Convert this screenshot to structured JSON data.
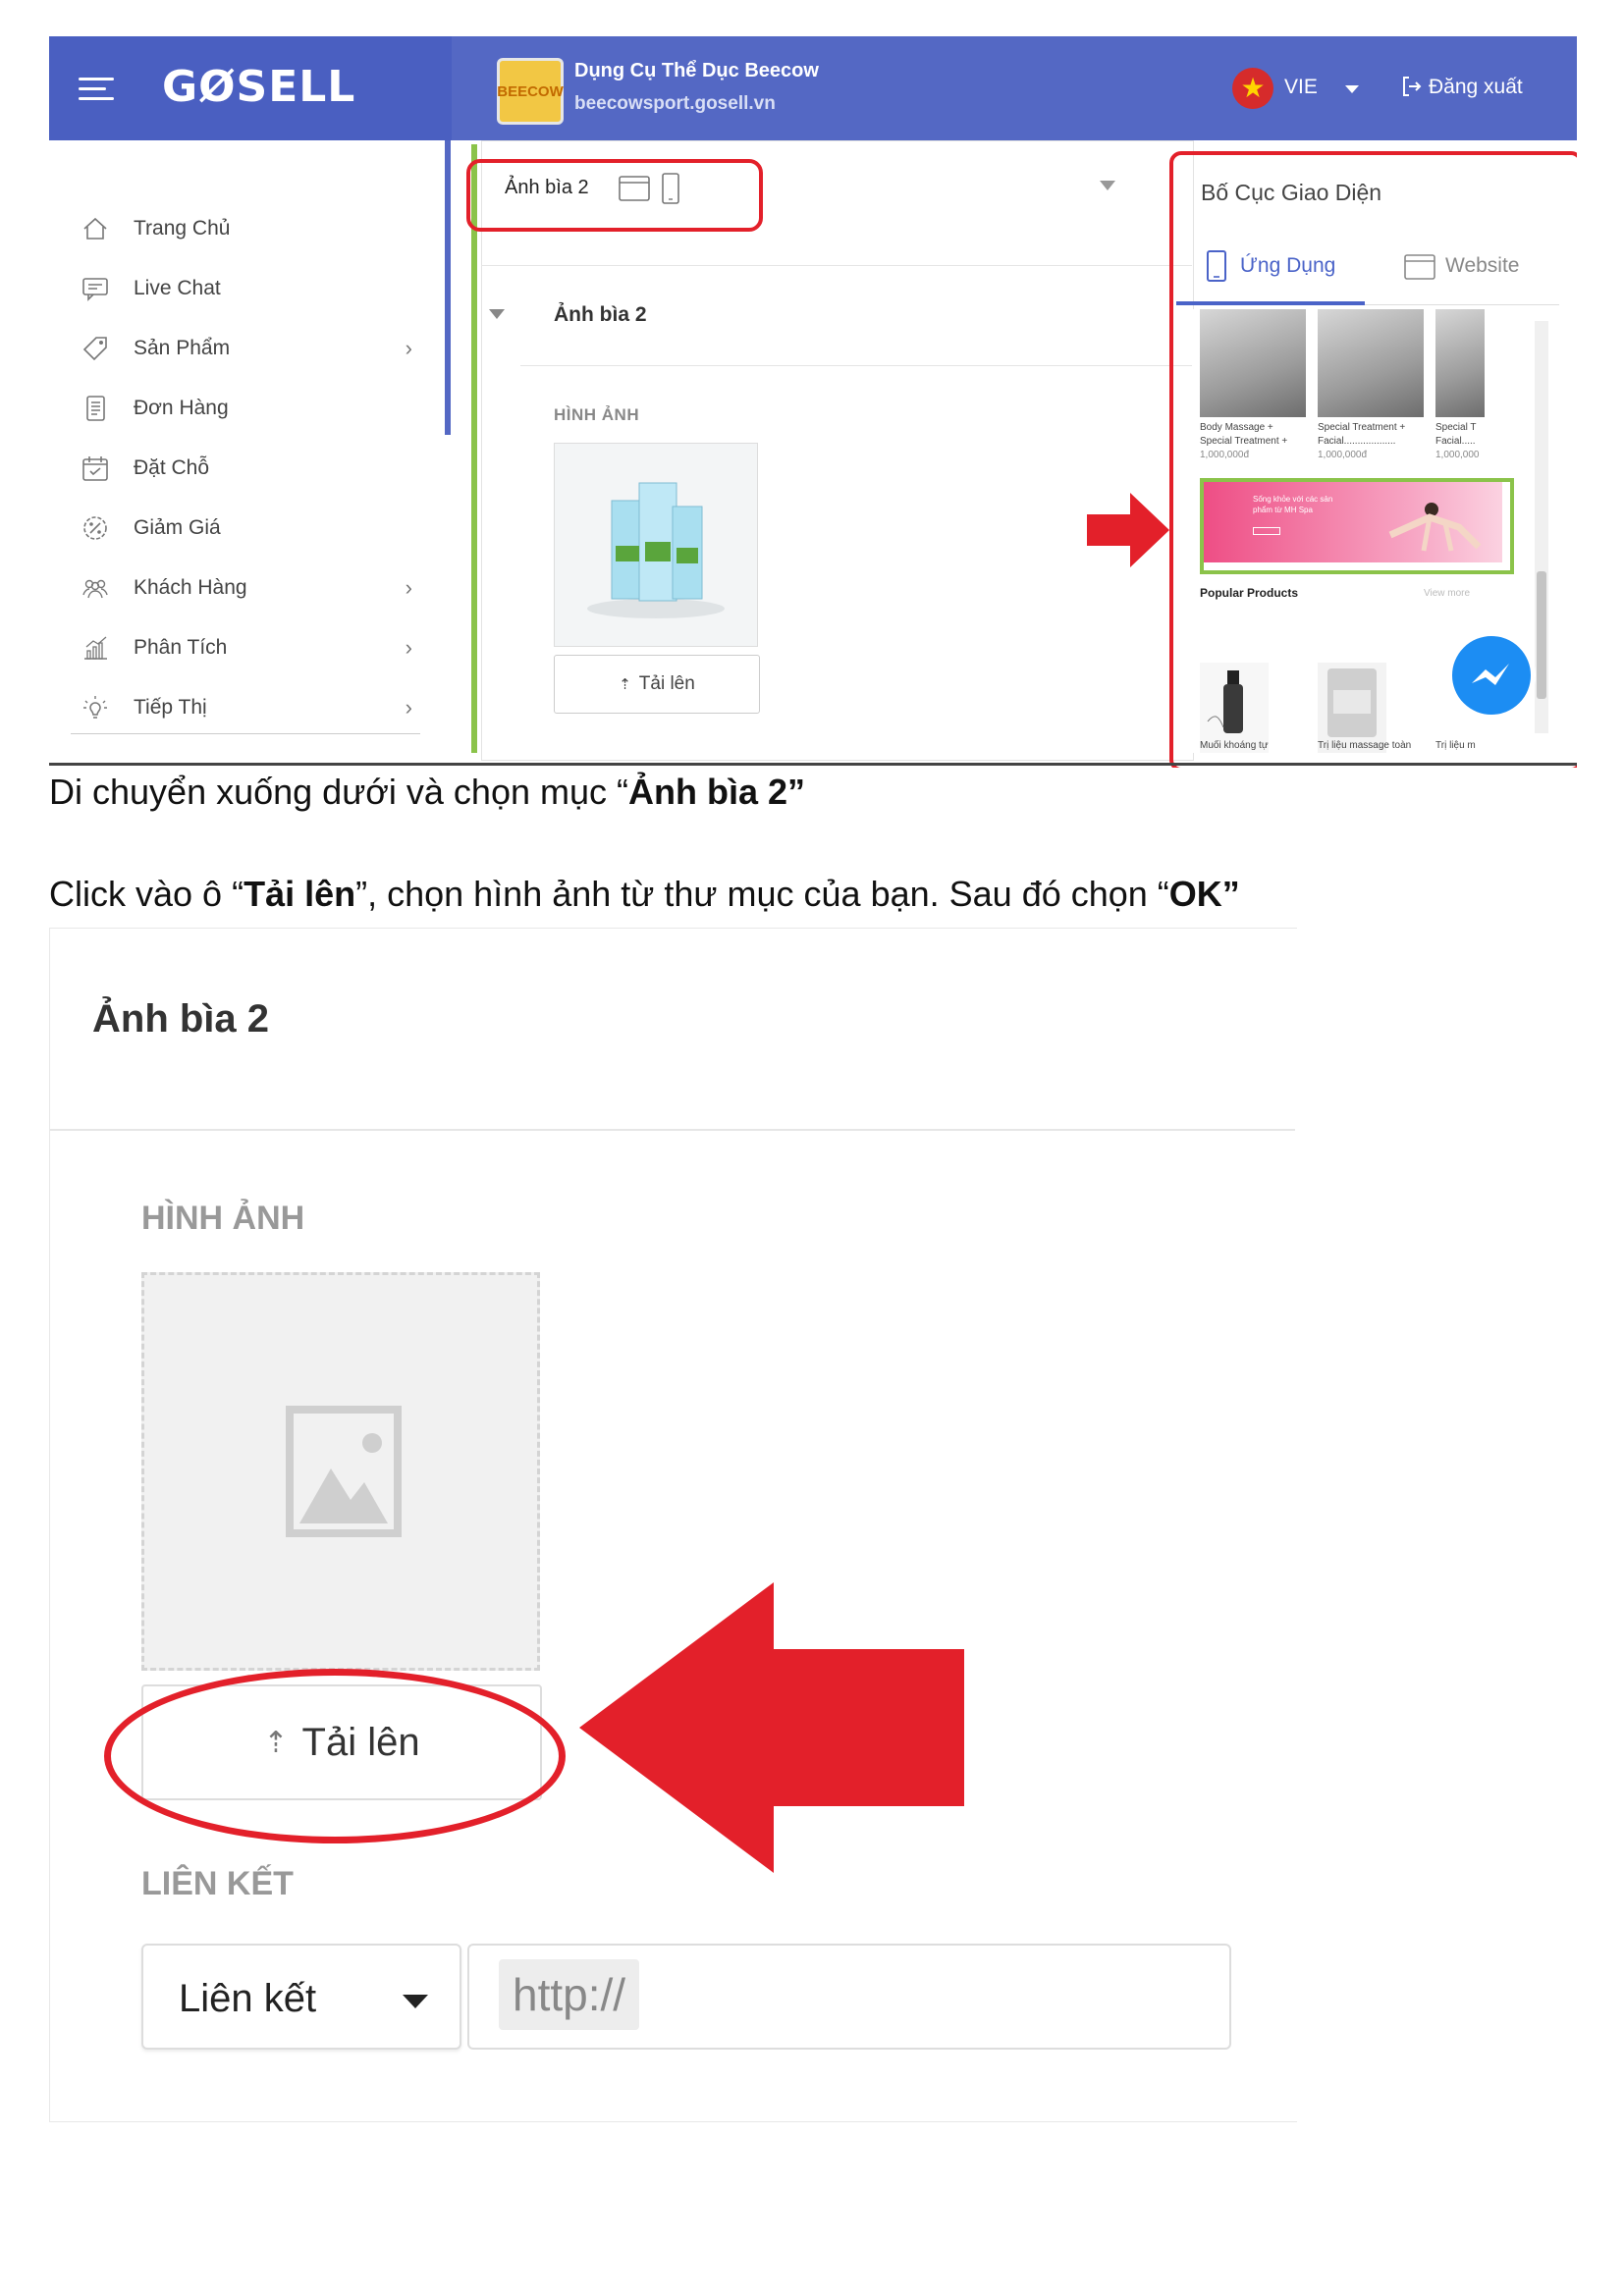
{
  "shot1": {
    "app_logo": "GØSELL",
    "shop": {
      "logo_text": "BEECOW",
      "name": "Dụng Cụ Thể Dục Beecow",
      "url": "beecowsport.gosell.vn"
    },
    "lang": "VIE",
    "logout": "Đăng xuất",
    "sidebar": {
      "items": [
        {
          "label": "Trang Chủ",
          "icon": "home-icon",
          "chevron": ""
        },
        {
          "label": "Live Chat",
          "icon": "chat-icon",
          "chevron": ""
        },
        {
          "label": "Sản Phẩm",
          "icon": "tag-icon",
          "chevron": "›"
        },
        {
          "label": "Đơn Hàng",
          "icon": "receipt-icon",
          "chevron": ""
        },
        {
          "label": "Đặt Chỗ",
          "icon": "calendar-icon",
          "chevron": ""
        },
        {
          "label": "Giảm Giá",
          "icon": "discount-icon",
          "chevron": ""
        },
        {
          "label": "Khách Hàng",
          "icon": "customers-icon",
          "chevron": "›"
        },
        {
          "label": "Phân Tích",
          "icon": "analytics-icon",
          "chevron": "›"
        },
        {
          "label": "Tiếp Thị",
          "icon": "bulb-icon",
          "chevron": "›"
        }
      ]
    },
    "editor": {
      "tab_label": "Ảnh bìa 2",
      "section_title": "Ảnh bìa 2",
      "image_label": "HÌNH ẢNH",
      "upload_label": "Tải lên"
    },
    "right_panel": {
      "title": "Bố Cục Giao Diện",
      "tab_app": "Ứng Dụng",
      "tab_web": "Website",
      "products_top": [
        {
          "name": "Body Massage + Special Treatment +",
          "price": "1,000,000đ"
        },
        {
          "name": "Special Treatment + Facial...................",
          "price": "1,000,000đ"
        },
        {
          "name": "Special T Facial.....",
          "price": "1,000,000"
        }
      ],
      "banner_text": "Sống khỏe với các sản phẩm từ MH Spa",
      "popular_title": "Popular Products",
      "view_more": "View more",
      "products_bottom": [
        "Muối khoáng tự",
        "Trị liệu massage toàn",
        "Trị liệu m"
      ]
    }
  },
  "instructions": {
    "line1": {
      "pre": "Di chuyển xuống dưới và chọn mục “",
      "bold": "Ảnh bìa 2”",
      "post": ""
    },
    "line2": {
      "pre": "Click vào ô “",
      "bold1": "Tải lên",
      "mid": "”, chọn hình ảnh từ thư mục của bạn. Sau đó chọn “",
      "bold2": "OK”"
    }
  },
  "shot2": {
    "title": "Ảnh bìa 2",
    "image_label": "HÌNH ẢNH",
    "upload_label": "Tải lên",
    "link_label": "LIÊN KẾT",
    "link_select": "Liên kết",
    "url_placeholder": "http://"
  },
  "colors": {
    "topbar": "#5468c4",
    "highlight_red": "#e3202a",
    "accent_green": "#8bc34a",
    "tab_blue": "#4a63c8"
  }
}
